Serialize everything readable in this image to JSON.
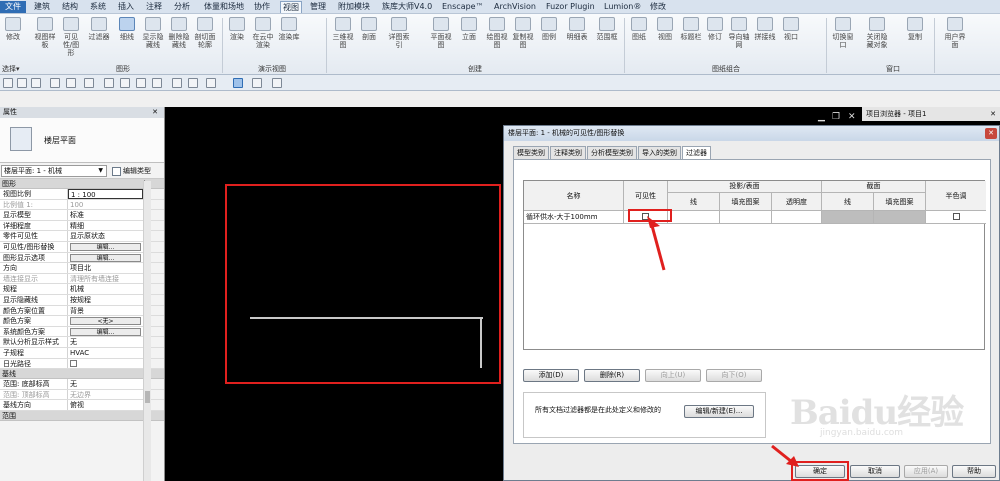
{
  "menubar": {
    "items": [
      "文件",
      "建筑",
      "结构",
      "系统",
      "插入",
      "注释",
      "分析",
      "体量和场地",
      "协作",
      "视图",
      "管理",
      "附加模块",
      "族库大师V4.0",
      "Enscape™",
      "ArchVision",
      "Fuzor Plugin",
      "Lumion®",
      "修改"
    ],
    "active": "视图"
  },
  "ribbon": {
    "buttons": [
      "修改",
      "视图样板",
      "可见性/图形",
      "过滤器",
      "细线",
      "显示隐藏线",
      "删除隐藏线",
      "剖切面轮廓",
      "渲染",
      "在云中渲染",
      "渲染库",
      "三维视图",
      "剖面",
      "详图索引",
      "平面视图",
      "立面",
      "绘图视图",
      "复制视图",
      "图例",
      "明细表",
      "范围框",
      "图纸",
      "视图",
      "标题栏",
      "修订",
      "导向轴网",
      "拼接线",
      "视口",
      "切换窗口",
      "关闭隐藏对象",
      "复制",
      "用户界面"
    ],
    "groups": [
      "选择▾",
      "图形",
      "演示视图",
      "创建",
      "图纸组合",
      "窗口"
    ]
  },
  "properties": {
    "title": "属性",
    "close": "✕",
    "type_name": "楼层平面",
    "selector": "楼层平面: 1 - 机械",
    "edit_type": "编辑类型",
    "sections": {
      "graphics": "图形",
      "extents": "基线",
      "range": "范围"
    },
    "rows": [
      {
        "k": "视图比例",
        "v": "1 : 100",
        "style": "boxed"
      },
      {
        "k": "比例值 1:",
        "v": "100",
        "style": "dim"
      },
      {
        "k": "显示模型",
        "v": "标准"
      },
      {
        "k": "详细程度",
        "v": "精细"
      },
      {
        "k": "零件可见性",
        "v": "显示原状态"
      },
      {
        "k": "可见性/图形替换",
        "v": "编辑...",
        "style": "button"
      },
      {
        "k": "图形显示选项",
        "v": "编辑...",
        "style": "button"
      },
      {
        "k": "方向",
        "v": "项目北"
      },
      {
        "k": "墙连接显示",
        "v": "清理所有墙连接",
        "style": "dim"
      },
      {
        "k": "规程",
        "v": "机械"
      },
      {
        "k": "显示隐藏线",
        "v": "按规程"
      },
      {
        "k": "颜色方案位置",
        "v": "背景"
      },
      {
        "k": "颜色方案",
        "v": "<无>",
        "style": "button"
      },
      {
        "k": "系统颜色方案",
        "v": "编辑...",
        "style": "button"
      },
      {
        "k": "默认分析显示样式",
        "v": "无"
      },
      {
        "k": "子规程",
        "v": "HVAC"
      },
      {
        "k": "日光路径",
        "v": "",
        "style": "checkbox"
      }
    ],
    "rows2": [
      {
        "k": "范围: 底部标高",
        "v": "无"
      },
      {
        "k": "范围: 顶部标高",
        "v": "无边界",
        "style": "dim"
      },
      {
        "k": "基线方向",
        "v": "俯视"
      }
    ]
  },
  "browser": {
    "title": "项目浏览器 - 项目1",
    "close": "✕"
  },
  "canvas_ctrls": {
    "min": "▁",
    "restore": "❐",
    "close": "✕"
  },
  "dialog": {
    "title": "楼层平面: 1 - 机械的可见性/图形替换",
    "close": "✕",
    "tabs": [
      "模型类别",
      "注释类别",
      "分析模型类别",
      "导入的类别",
      "过滤器"
    ],
    "active_tab": "过滤器",
    "grid": {
      "headers": {
        "name": "名称",
        "visibility": "可见性",
        "projection": "投影/表面",
        "cut": "截面",
        "halftone": "半色调",
        "proj_line": "线",
        "proj_fill": "填充图案",
        "proj_transparency": "透明度",
        "cut_line": "线",
        "cut_fill": "填充图案"
      },
      "rows": [
        {
          "name": "循环供水-大于100mm",
          "visible": false,
          "halftone": false
        }
      ]
    },
    "buttons": {
      "add": "添加(D)",
      "remove": "删除(R)",
      "up": "向上(U)",
      "down": "向下(O)",
      "edit_new": "编辑/新建(E)...",
      "ok": "确定",
      "cancel": "取消",
      "apply": "应用(A)",
      "help": "帮助"
    },
    "info": "所有文档过滤器都是在此处定义和修改的"
  },
  "watermark": {
    "brand": "Baidu经验",
    "url": "jingyan.baidu.com"
  },
  "colors": {
    "annotation_red": "#e0201e",
    "ribbon_blue": "#2f6db4"
  }
}
